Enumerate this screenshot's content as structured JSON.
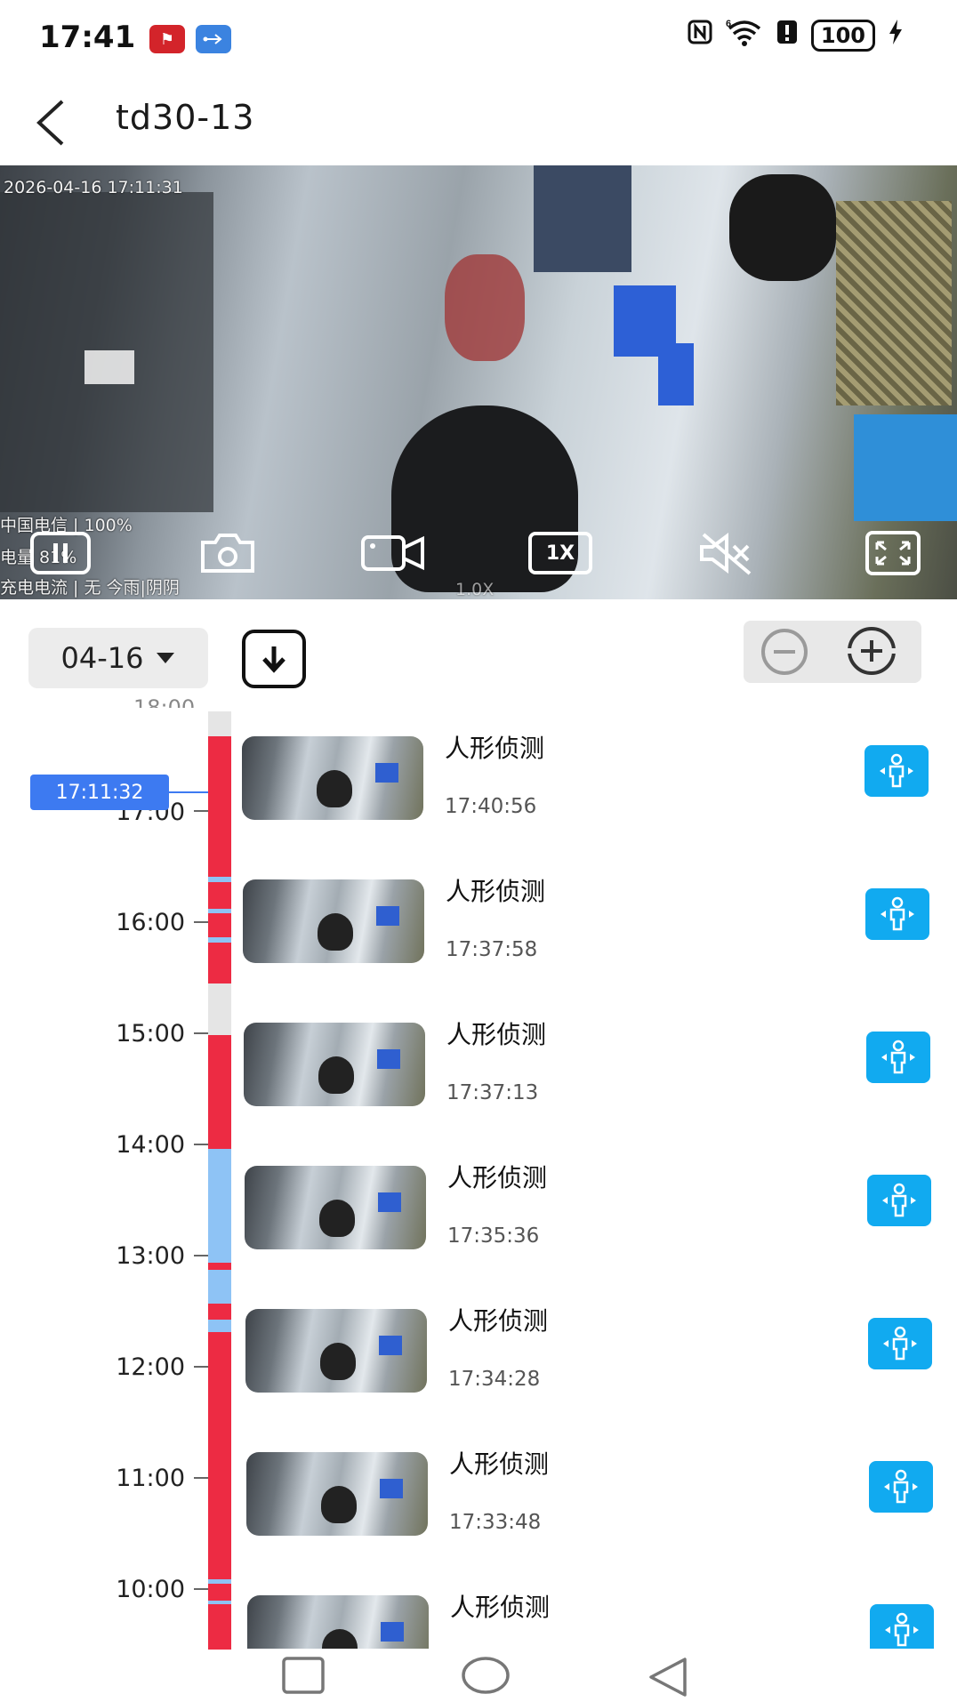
{
  "status_bar": {
    "time": "17:41",
    "apps": [
      {
        "icon": "app-red-logo-icon",
        "color": "#d3242a"
      },
      {
        "icon": "usb-icon",
        "color": "#3b83e0"
      }
    ],
    "icons": [
      "nfc-icon",
      "wifi-6-icon",
      "alert-icon"
    ],
    "battery": "100"
  },
  "header": {
    "title": "td30-13"
  },
  "video": {
    "overlay_timestamp": "2026-04-16  17:11:31",
    "overlay_lines": [
      "中国电信 | 100%",
      "电量 81%",
      "充电电流 | 无 今雨|阴阴"
    ],
    "zoom_overlay": "1.0X",
    "speed_label": "1X",
    "controls": [
      "pause",
      "screenshot",
      "record",
      "speed",
      "mute",
      "fullscreen"
    ]
  },
  "controls_row": {
    "date": "04-16"
  },
  "timeline": {
    "current_time": "17:11:32",
    "top_partial_label": "18:00",
    "hour_labels": [
      "17:00",
      "16:00",
      "15:00",
      "14:00",
      "13:00",
      "12:00",
      "11:00",
      "10:00"
    ],
    "colors": {
      "recorded": "#ed2b43",
      "continuous": "#8ec3f5",
      "gap": "#e5e5e5"
    }
  },
  "events": [
    {
      "title": "人形侦测",
      "time": "17:40:56"
    },
    {
      "title": "人形侦测",
      "time": "17:37:58"
    },
    {
      "title": "人形侦测",
      "time": "17:37:13"
    },
    {
      "title": "人形侦测",
      "time": "17:35:36"
    },
    {
      "title": "人形侦测",
      "time": "17:34:28"
    },
    {
      "title": "人形侦测",
      "time": "17:33:48"
    },
    {
      "title": "人形侦测",
      "time": ""
    }
  ],
  "nav_bar": [
    "recents",
    "home",
    "back"
  ]
}
